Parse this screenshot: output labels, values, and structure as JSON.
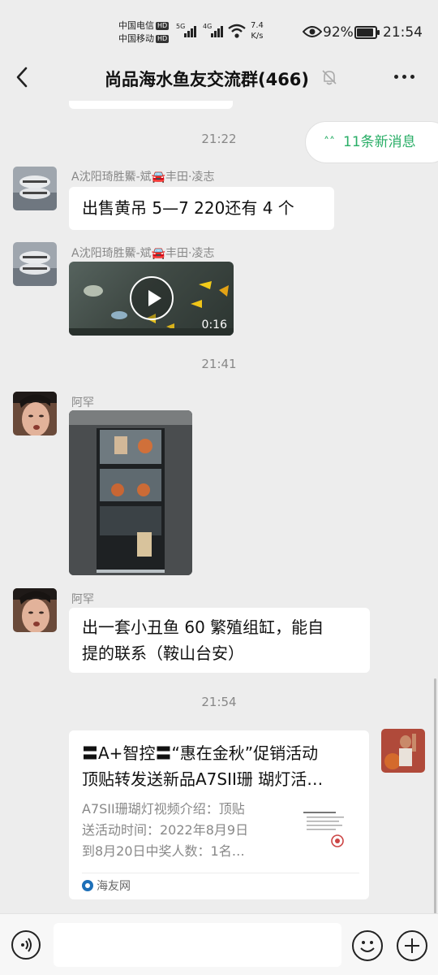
{
  "status_bar": {
    "carrier1": "中国电信",
    "carrier2": "中国移动",
    "hd": "HD",
    "net1": "5G",
    "net2": "4G",
    "speed_value": "7.4",
    "speed_unit": "K/s",
    "battery_percent": "92%",
    "battery_level": 0.92,
    "time": "21:54"
  },
  "header": {
    "title": "尚品海水鱼友交流群(466)"
  },
  "new_messages_label": "11条新消息",
  "timestamps": [
    "21:22",
    "21:41",
    "21:54"
  ],
  "messages": [
    {
      "sender": "A沈阳琦胜鱀-斌🚘丰田·凌志",
      "text": "出售黄吊 5—7   220还有 4 个"
    },
    {
      "sender": "A沈阳琦胜鱀-斌🚘丰田·凌志",
      "video_duration": "0:16"
    },
    {
      "sender": "阿罕"
    },
    {
      "sender": "阿罕",
      "text_line1": "出一套小丑鱼 60 繁殖组缸，能自",
      "text_line2": "提的联系（鞍山台安）"
    }
  ],
  "link_card": {
    "title_line1": "〓A+智控〓“惠在金秋”促销活动",
    "title_line2": "顶贴转发送新品A7SII珊 瑚灯活…",
    "desc_line1": "A7SII珊瑚灯视频介绍：顶贴",
    "desc_line2": "送活动时间：2022年8月9日",
    "desc_line3": "到8月20日中奖人数：1名…",
    "source": "海友网"
  },
  "icons": {
    "back": "back-arrow-icon",
    "mute": "bell-off-icon",
    "more": "more-dots-icon",
    "voice": "voice-icon",
    "emoji": "emoji-icon",
    "plus": "plus-icon"
  },
  "colors": {
    "background": "#ededed",
    "accent_green": "#2aae67",
    "bubble": "#ffffff"
  }
}
